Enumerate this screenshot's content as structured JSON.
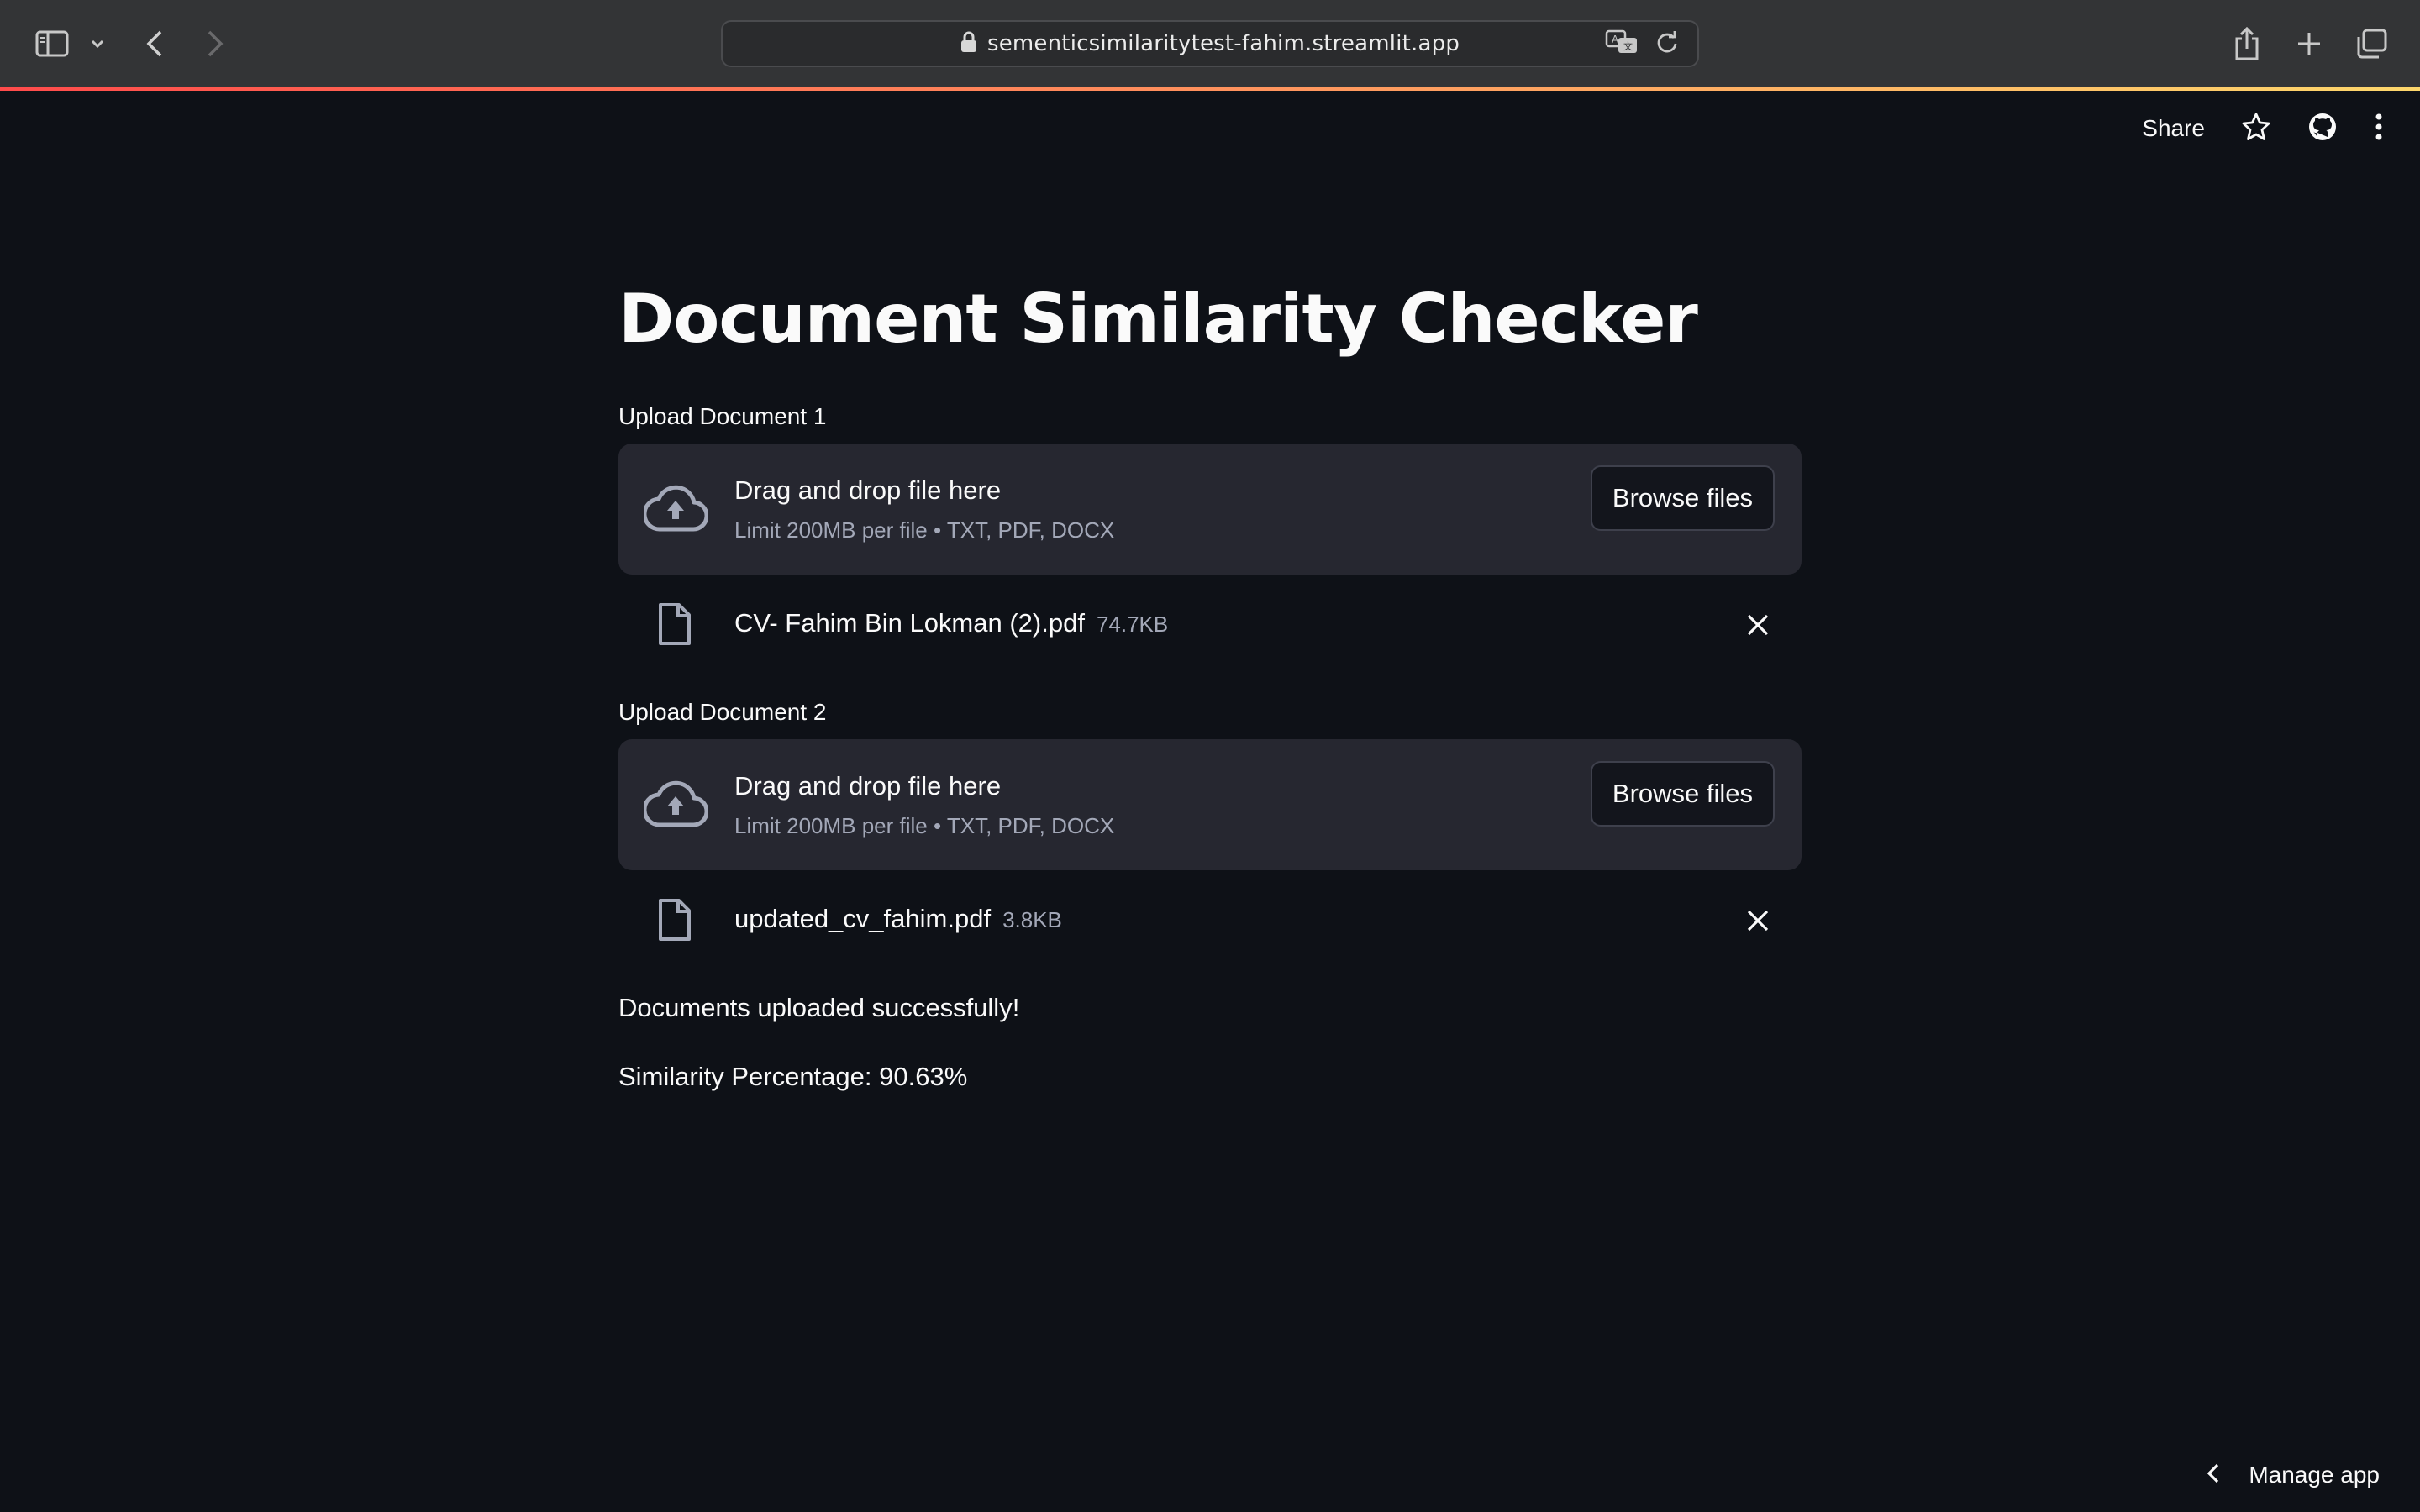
{
  "browser": {
    "url": "sementicsimilaritytest-fahim.streamlit.app"
  },
  "header": {
    "share_label": "Share"
  },
  "main": {
    "title": "Document Similarity Checker",
    "uploaders": [
      {
        "label": "Upload Document 1",
        "drop_title": "Drag and drop file here",
        "drop_subtitle": "Limit 200MB per file • TXT, PDF, DOCX",
        "browse_label": "Browse files",
        "file": {
          "name": "CV- Fahim Bin Lokman (2).pdf",
          "size": "74.7KB"
        }
      },
      {
        "label": "Upload Document 2",
        "drop_title": "Drag and drop file here",
        "drop_subtitle": "Limit 200MB per file • TXT, PDF, DOCX",
        "browse_label": "Browse files",
        "file": {
          "name": "updated_cv_fahim.pdf",
          "size": "3.8KB"
        }
      }
    ],
    "status_message": "Documents uploaded successfully!",
    "similarity_text": "Similarity Percentage: 90.63%"
  },
  "footer": {
    "manage_label": "Manage app"
  },
  "colors": {
    "background": "#0e1117",
    "dropzone": "#262730",
    "chrome": "#333436"
  }
}
